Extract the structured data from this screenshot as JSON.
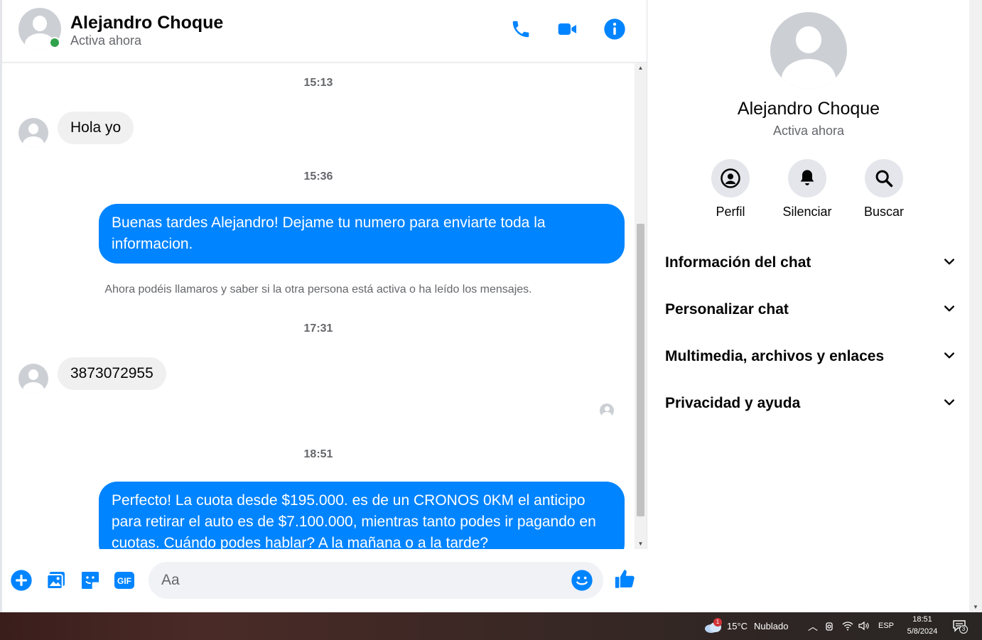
{
  "header": {
    "contact_name": "Alejandro Choque",
    "status": "Activa ahora",
    "icons": [
      "phone-icon",
      "video-icon",
      "info-icon"
    ]
  },
  "messages": {
    "timestamps": [
      "15:13",
      "15:36",
      "17:31",
      "18:51"
    ],
    "incoming": [
      "Hola yo",
      "3873072955"
    ],
    "outgoing": [
      "Buenas tardes Alejandro! Dejame tu numero para enviarte toda la informacion.",
      "Perfecto! La cuota desde $195.000. es de un CRONOS 0KM el anticipo para retirar el auto es de $7.100.000, mientras tanto podes ir pagando en cuotas. Cuándo podes hablar? A la mañana o a la tarde?"
    ],
    "system_note": "Ahora podéis llamaros y saber si la otra persona está activa o ha leído los mensajes."
  },
  "composer": {
    "placeholder": "Aa",
    "icons": [
      "plus-icon",
      "image-icon",
      "sticker-icon",
      "gif-icon",
      "emoji-icon",
      "like-icon"
    ],
    "gif_label": "GIF"
  },
  "info": {
    "name": "Alejandro Choque",
    "status": "Activa ahora",
    "actions": [
      {
        "label": "Perfil",
        "icon": "profile-icon"
      },
      {
        "label": "Silenciar",
        "icon": "bell-icon"
      },
      {
        "label": "Buscar",
        "icon": "search-icon"
      }
    ],
    "sections": [
      "Información del chat",
      "Personalizar chat",
      "Multimedia, archivos y enlaces",
      "Privacidad y ayuda"
    ]
  },
  "taskbar": {
    "weather_temp": "15°C",
    "weather_text": "Nublado",
    "weather_badge": "1",
    "language": "ESP",
    "time": "18:51",
    "date": "5/8/2024",
    "notification_count": "3"
  },
  "colors": {
    "accent": "#0084ff",
    "online": "#31a24c",
    "incoming_bubble": "#f0f0f0"
  }
}
